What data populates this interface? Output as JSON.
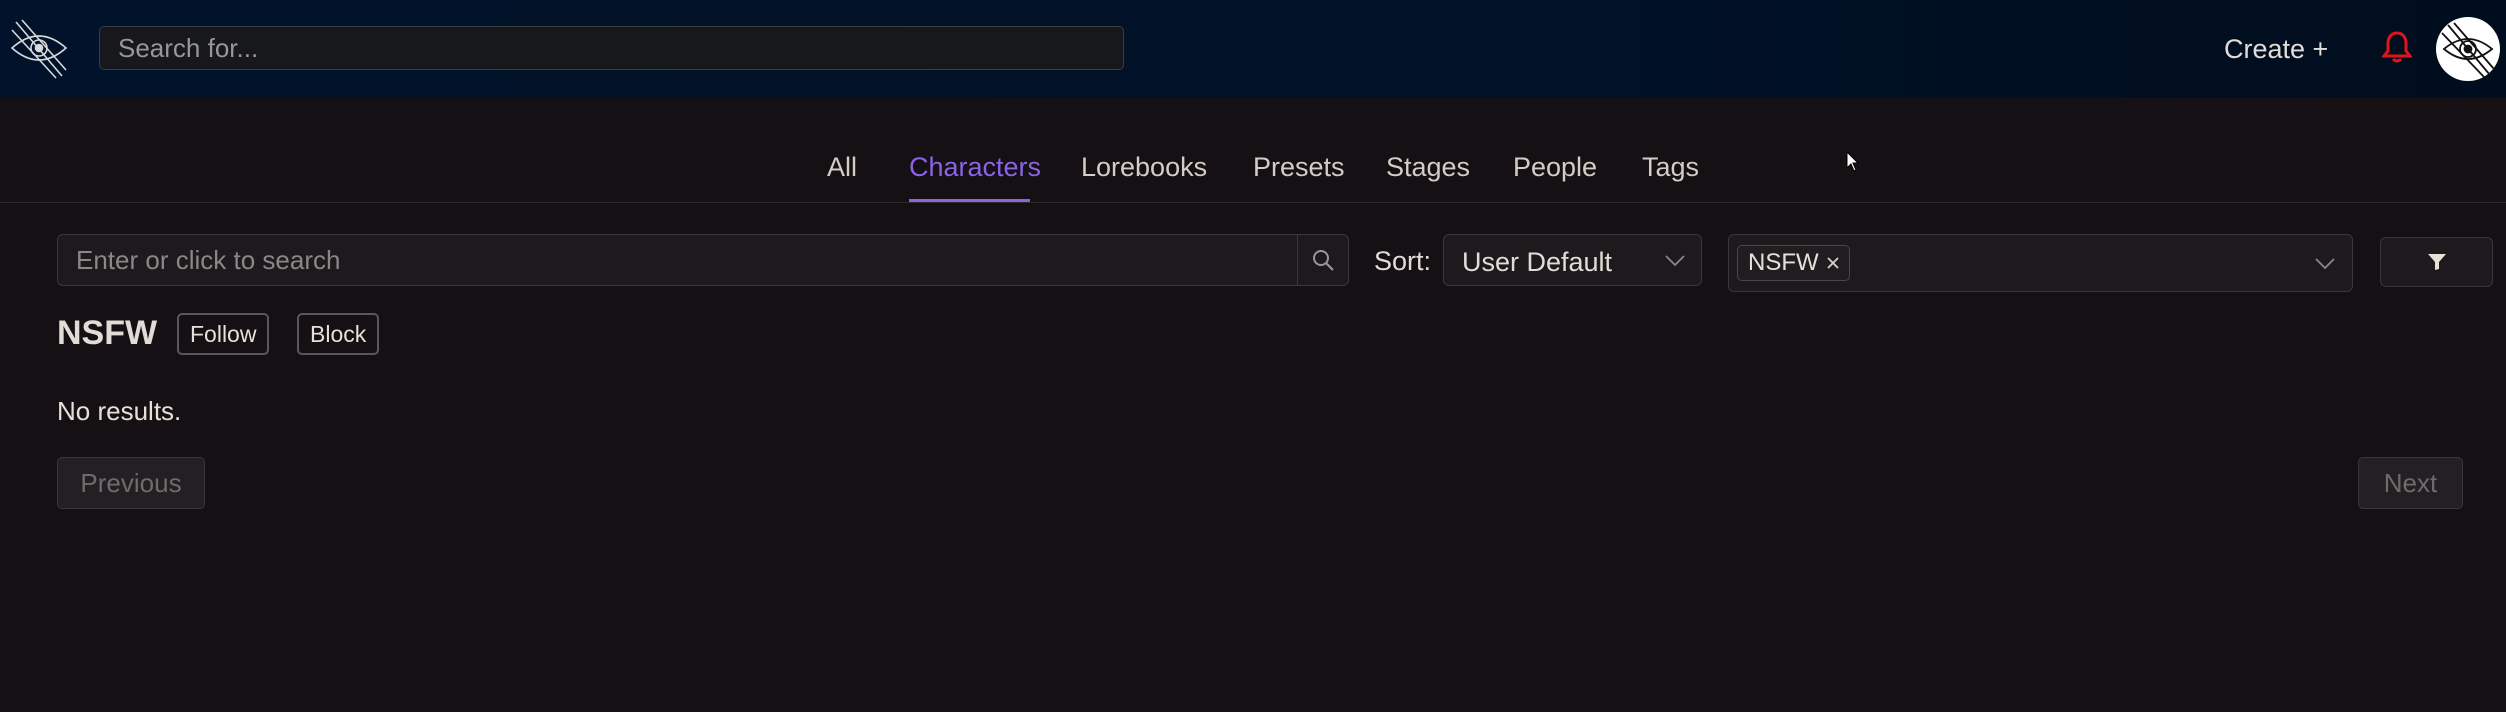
{
  "header": {
    "search_placeholder": "Search for...",
    "create_label": "Create +"
  },
  "tabs": [
    {
      "label": "All"
    },
    {
      "label": "Characters",
      "active": true
    },
    {
      "label": "Lorebooks"
    },
    {
      "label": "Presets"
    },
    {
      "label": "Stages"
    },
    {
      "label": "People"
    },
    {
      "label": "Tags"
    }
  ],
  "filters": {
    "search_placeholder": "Enter or click to search",
    "sort_label": "Sort:",
    "sort_value": "User Default",
    "selected_tags": [
      "NSFW"
    ]
  },
  "tag_page": {
    "title": "NSFW",
    "follow_label": "Follow",
    "block_label": "Block",
    "empty_text": "No results."
  },
  "pagination": {
    "previous_label": "Previous",
    "next_label": "Next"
  },
  "colors": {
    "accent": "#8a63e6",
    "notification": "#e0141e",
    "header_bg": "#011228",
    "page_bg": "#141013"
  },
  "icons": {
    "logo": "eye-logo-icon",
    "notification": "bell-icon",
    "search": "search-icon",
    "filter": "filter-funnel-icon"
  }
}
